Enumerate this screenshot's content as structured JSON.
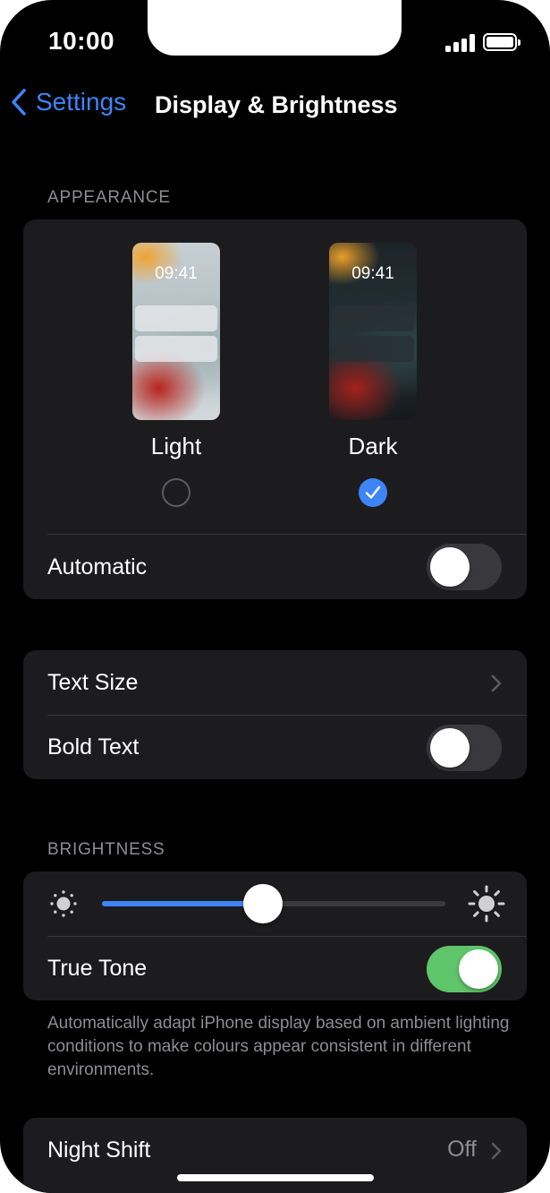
{
  "status_bar": {
    "time": "10:00",
    "signal_icon": "signal-bars-icon",
    "battery_icon": "battery-full-icon"
  },
  "nav": {
    "back_label": "Settings",
    "title": "Display & Brightness"
  },
  "appearance": {
    "header": "APPEARANCE",
    "light": {
      "label": "Light",
      "time": "09:41",
      "selected": false
    },
    "dark": {
      "label": "Dark",
      "time": "09:41",
      "selected": true
    },
    "automatic": {
      "label": "Automatic",
      "on": false
    }
  },
  "text": {
    "text_size": {
      "label": "Text Size"
    },
    "bold_text": {
      "label": "Bold Text",
      "on": false
    }
  },
  "brightness": {
    "header": "BRIGHTNESS",
    "level": 0.47,
    "true_tone": {
      "label": "True Tone",
      "on": true
    },
    "footer": "Automatically adapt iPhone display based on ambient lighting conditions to make colours appear consistent in different environments."
  },
  "night_shift": {
    "label": "Night Shift",
    "value": "Off"
  },
  "colors": {
    "accent": "#3d85f7",
    "toggle_on": "#5fc56a",
    "group_background": "#1c1c1e",
    "secondary_text": "#8d8d92"
  }
}
